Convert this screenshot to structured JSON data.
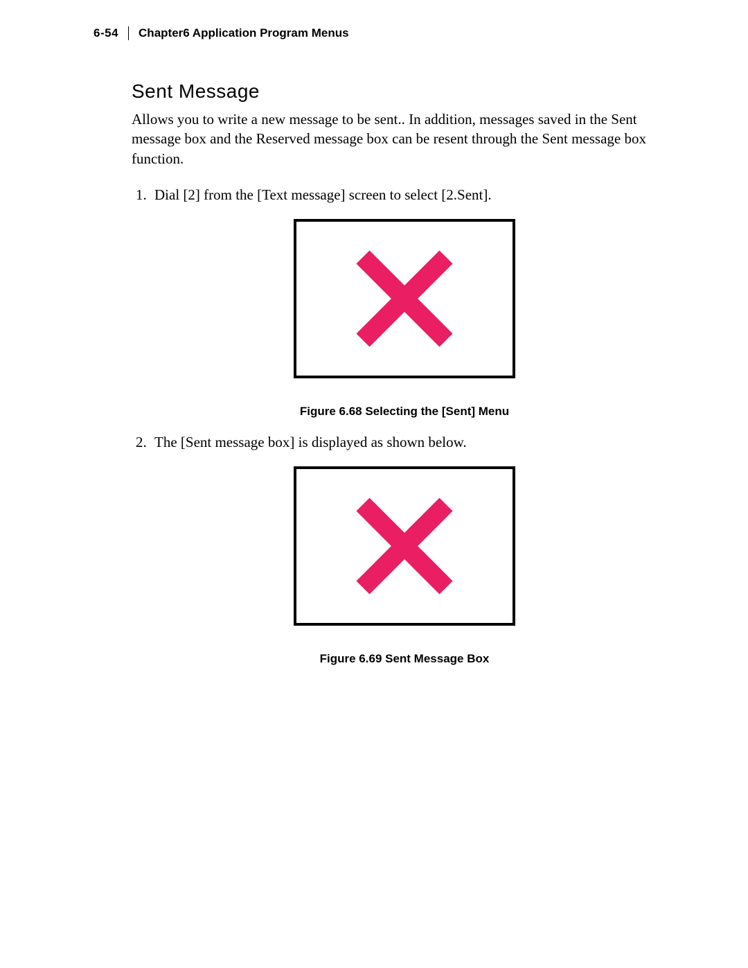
{
  "header": {
    "page_number": "6-54",
    "chapter_label": "Chapter6  Application Program Menus"
  },
  "section": {
    "title": "Sent Message",
    "intro": "Allows you to write a new message to be sent.. In addition, messages saved in the Sent message box and the Reserved message box can be resent through the Sent message box function."
  },
  "steps": [
    {
      "text": "Dial [2] from the [Text message] screen to select [2.Sent].",
      "figure_caption": "Figure 6.68  Selecting the [Sent] Menu"
    },
    {
      "text": "The [Sent message box] is displayed as shown below.",
      "figure_caption": "Figure 6.69  Sent Message Box"
    }
  ],
  "icon_color": "#e91e63"
}
